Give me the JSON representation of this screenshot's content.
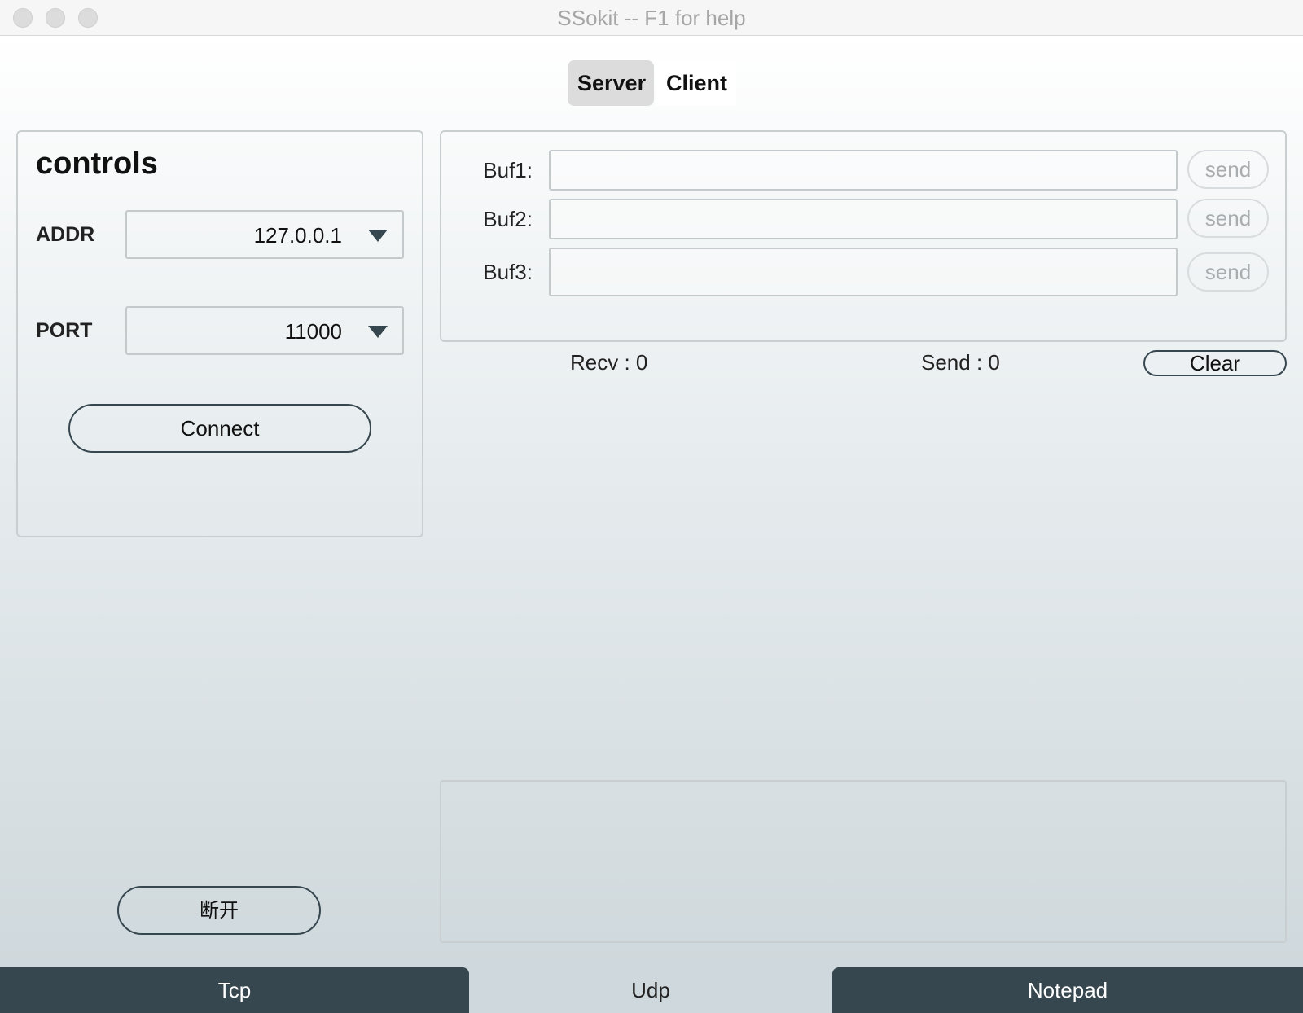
{
  "window": {
    "title": "SSokit -- F1 for help"
  },
  "mode_tabs": {
    "server": "Server",
    "client": "Client",
    "selected": "Server"
  },
  "controls": {
    "title": "controls",
    "addr_label": "ADDR",
    "addr_value": "127.0.0.1",
    "port_label": "PORT",
    "port_value": "11000",
    "connect_label": "Connect",
    "disconnect_label": "断开"
  },
  "buffers": [
    {
      "label": "Buf1:",
      "value": "",
      "send_label": "send"
    },
    {
      "label": "Buf2:",
      "value": "",
      "send_label": "send"
    },
    {
      "label": "Buf3:",
      "value": "",
      "send_label": "send"
    }
  ],
  "stats": {
    "recv": "Recv : 0",
    "send": "Send : 0",
    "clear_label": "Clear"
  },
  "log": {
    "text": ""
  },
  "bottom_tabs": {
    "items": [
      "Tcp",
      "Udp",
      "Notepad"
    ],
    "active": "Udp"
  },
  "colors": {
    "dark_tab": "#37474f",
    "active_tab": "#cfd8dc",
    "segment_selected": "#dcdcdc"
  }
}
